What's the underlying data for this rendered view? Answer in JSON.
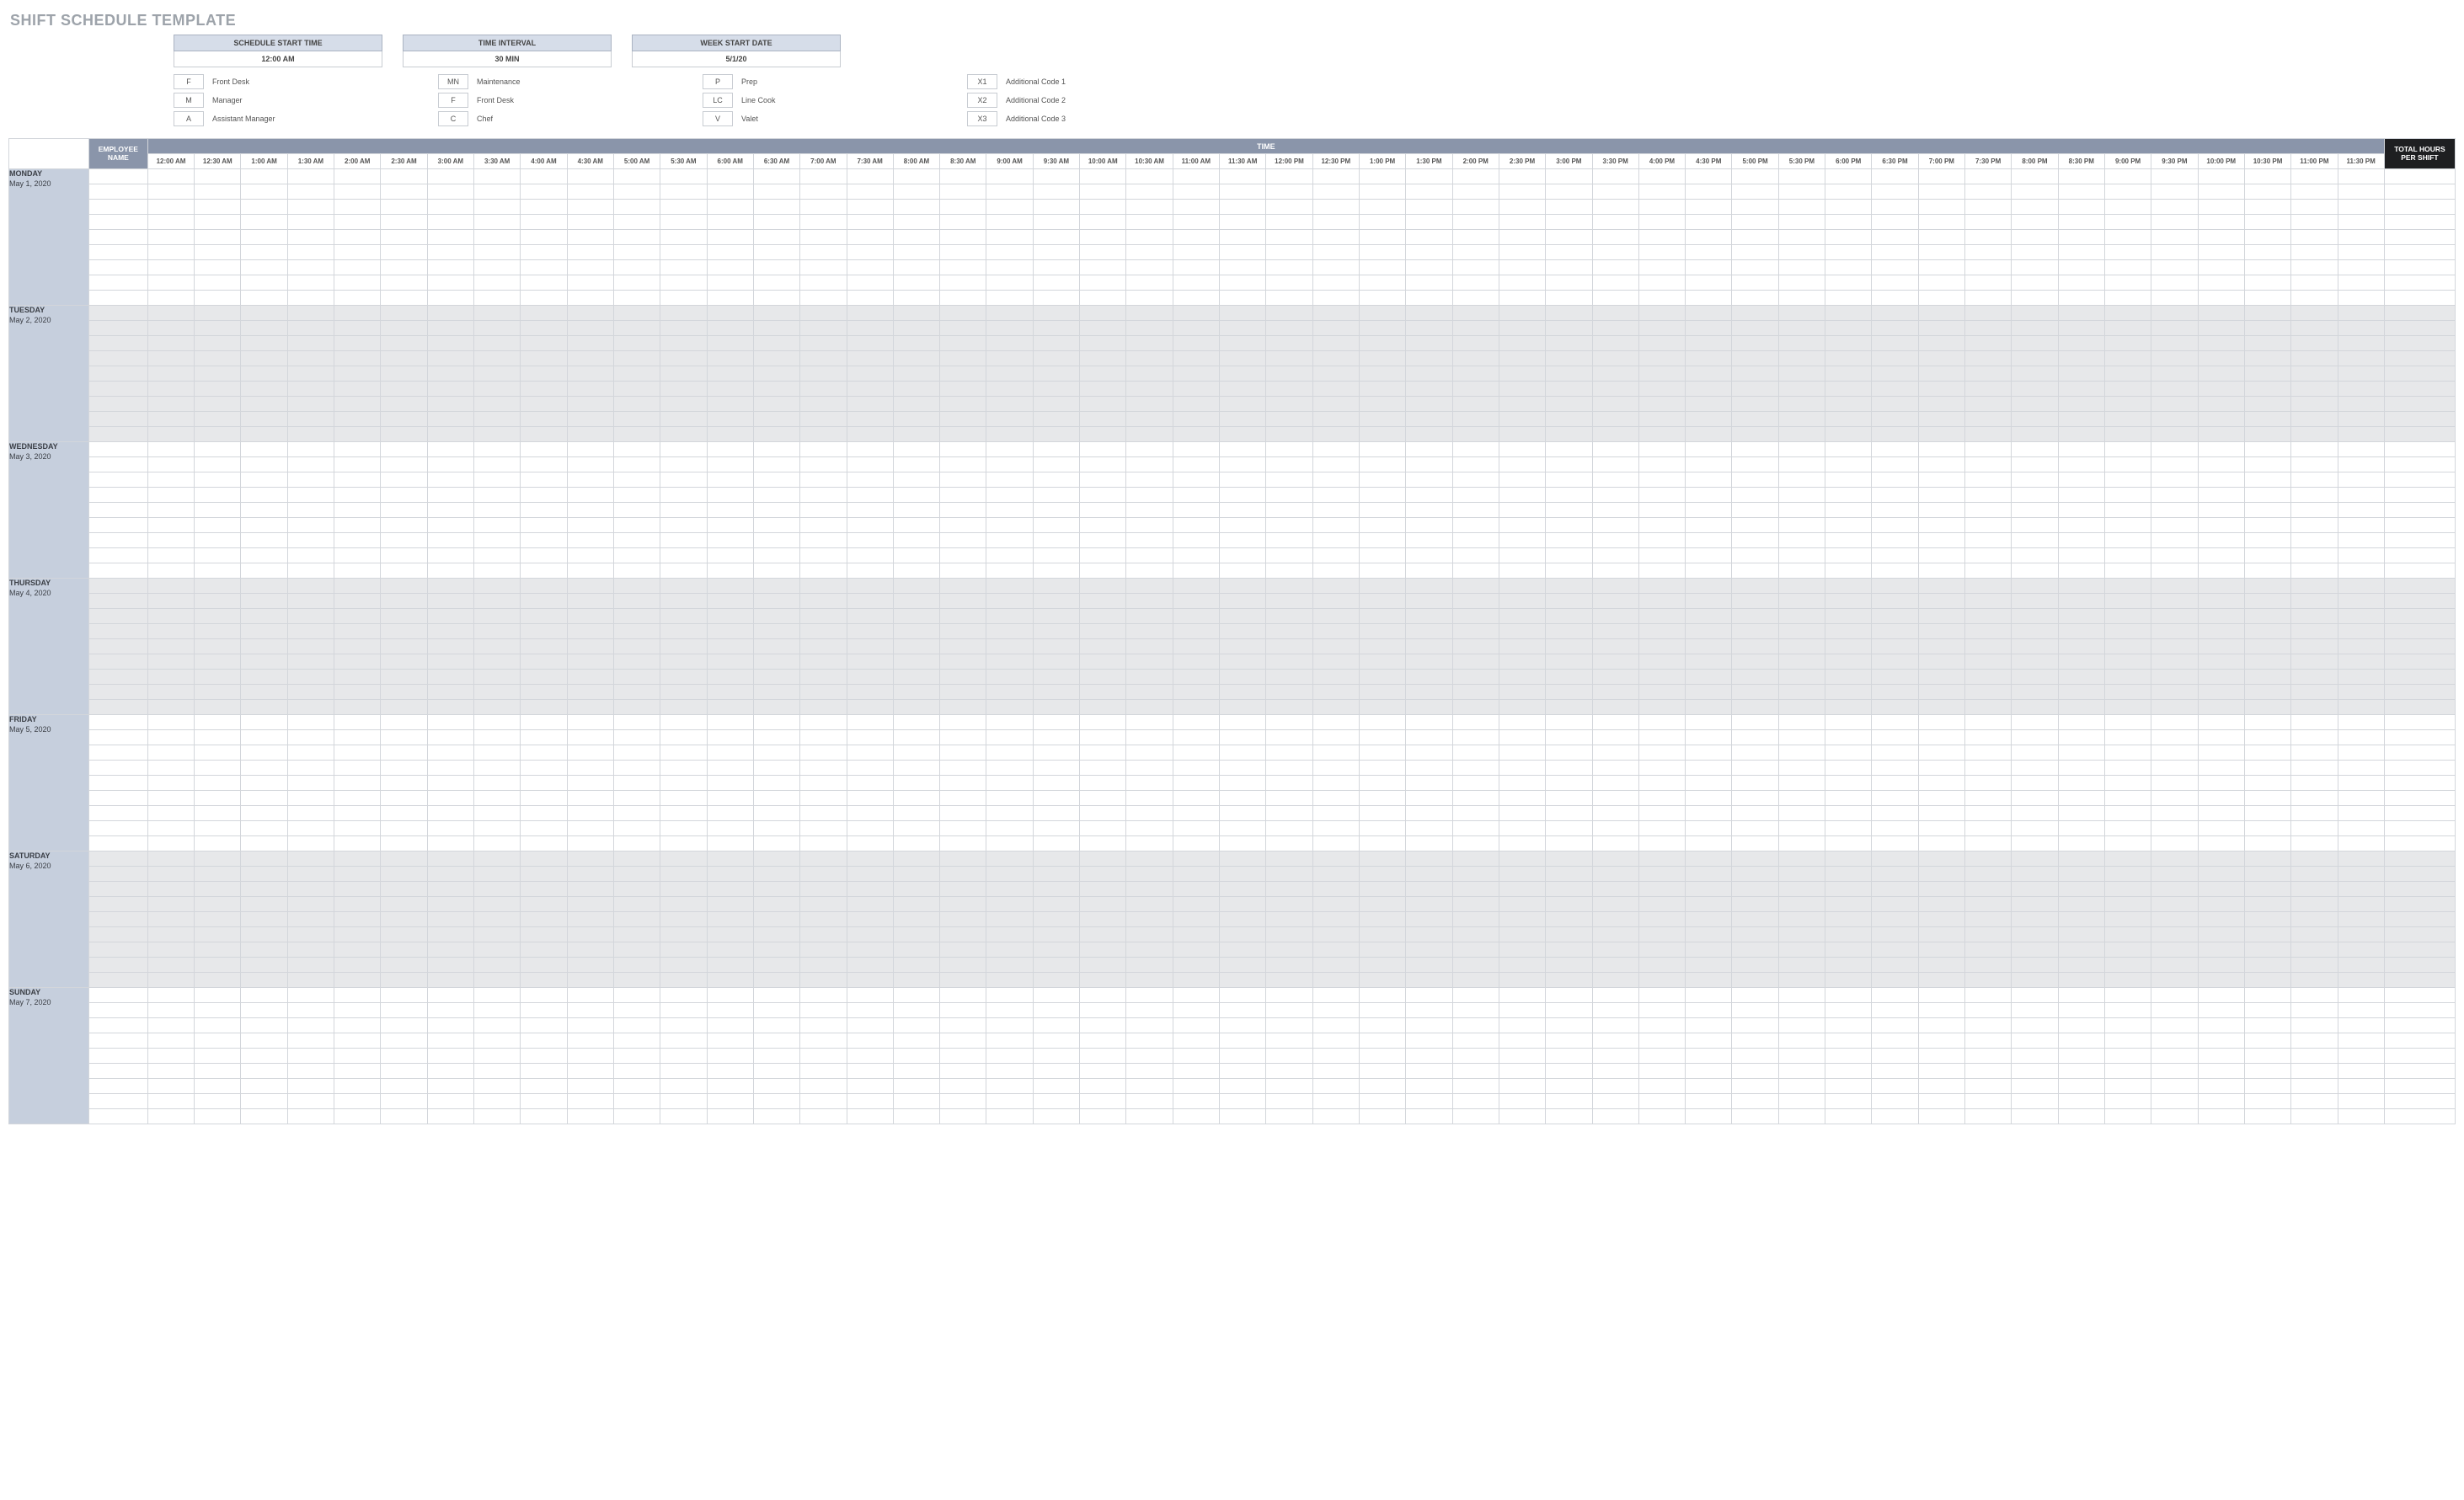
{
  "title": "SHIFT SCHEDULE TEMPLATE",
  "config": [
    {
      "header": "SCHEDULE START TIME",
      "value": "12:00 AM"
    },
    {
      "header": "TIME INTERVAL",
      "value": "30 MIN"
    },
    {
      "header": "WEEK START DATE",
      "value": "5/1/20"
    }
  ],
  "legend": [
    [
      {
        "code": "F",
        "label": "Front Desk"
      },
      {
        "code": "M",
        "label": "Manager"
      },
      {
        "code": "A",
        "label": "Assistant Manager"
      }
    ],
    [
      {
        "code": "MN",
        "label": "Maintenance"
      },
      {
        "code": "F",
        "label": "Front Desk"
      },
      {
        "code": "C",
        "label": "Chef"
      }
    ],
    [
      {
        "code": "P",
        "label": "Prep"
      },
      {
        "code": "LC",
        "label": "Line Cook"
      },
      {
        "code": "V",
        "label": "Valet"
      }
    ],
    [
      {
        "code": "X1",
        "label": "Additional Code 1"
      },
      {
        "code": "X2",
        "label": "Additional Code 2"
      },
      {
        "code": "X3",
        "label": "Additional Code 3"
      }
    ]
  ],
  "headers": {
    "employee": "EMPLOYEE NAME",
    "time_group": "TIME",
    "total": "TOTAL HOURS PER SHIFT"
  },
  "times": [
    "12:00 AM",
    "12:30 AM",
    "1:00 AM",
    "1:30 AM",
    "2:00 AM",
    "2:30 AM",
    "3:00 AM",
    "3:30 AM",
    "4:00 AM",
    "4:30 AM",
    "5:00 AM",
    "5:30 AM",
    "6:00 AM",
    "6:30 AM",
    "7:00 AM",
    "7:30 AM",
    "8:00 AM",
    "8:30 AM",
    "9:00 AM",
    "9:30 AM",
    "10:00 AM",
    "10:30 AM",
    "11:00 AM",
    "11:30 AM",
    "12:00 PM",
    "12:30 PM",
    "1:00 PM",
    "1:30 PM",
    "2:00 PM",
    "2:30 PM",
    "3:00 PM",
    "3:30 PM",
    "4:00 PM",
    "4:30 PM",
    "5:00 PM",
    "5:30 PM",
    "6:00 PM",
    "6:30 PM",
    "7:00 PM",
    "7:30 PM",
    "8:00 PM",
    "8:30 PM",
    "9:00 PM",
    "9:30 PM",
    "10:00 PM",
    "10:30 PM",
    "11:00 PM",
    "11:30 PM"
  ],
  "days": [
    {
      "dow": "MONDAY",
      "date": "May 1, 2020",
      "shaded": false
    },
    {
      "dow": "TUESDAY",
      "date": "May 2, 2020",
      "shaded": true
    },
    {
      "dow": "WEDNESDAY",
      "date": "May 3, 2020",
      "shaded": false
    },
    {
      "dow": "THURSDAY",
      "date": "May 4, 2020",
      "shaded": true
    },
    {
      "dow": "FRIDAY",
      "date": "May 5, 2020",
      "shaded": false
    },
    {
      "dow": "SATURDAY",
      "date": "May 6, 2020",
      "shaded": true
    },
    {
      "dow": "SUNDAY",
      "date": "May 7, 2020",
      "shaded": false
    }
  ],
  "rows_per_day": 9
}
